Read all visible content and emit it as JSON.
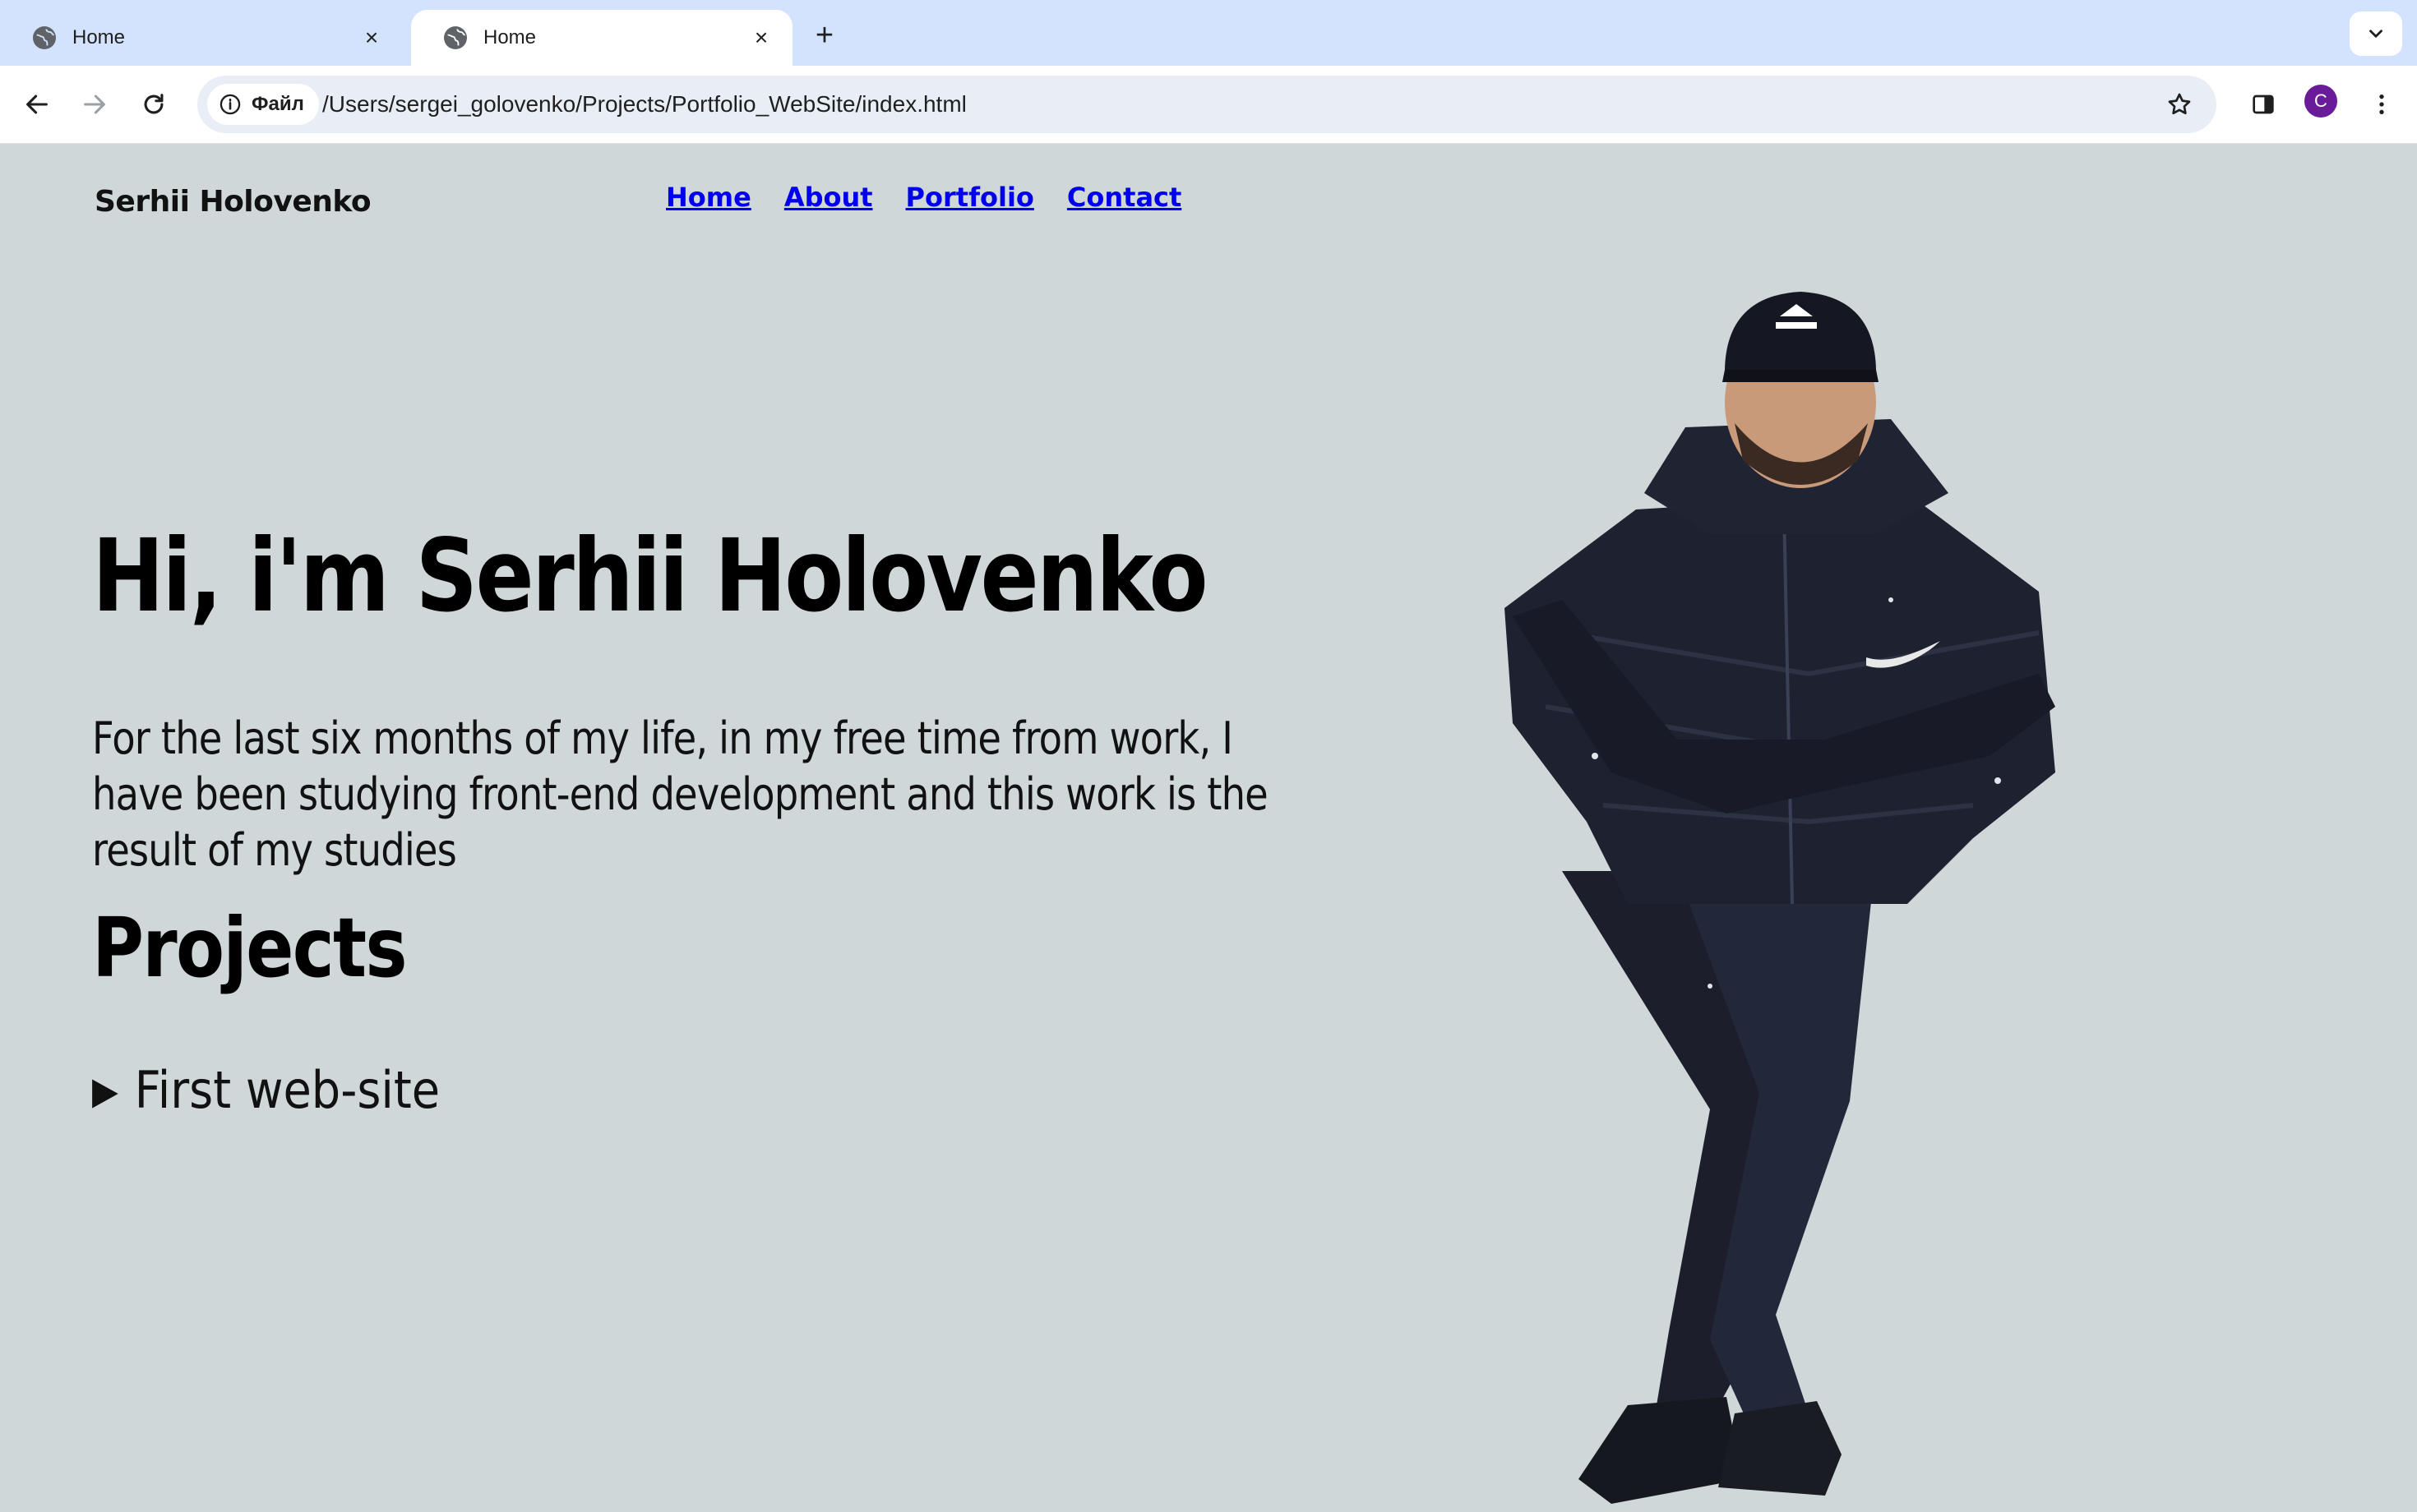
{
  "browser": {
    "tabs": [
      {
        "title": "Home",
        "active": false
      },
      {
        "title": "Home",
        "active": true
      }
    ],
    "new_tab_symbol": "+",
    "close_symbol": "×",
    "site_info_label": "Файл",
    "url": "/Users/sergei_golovenko/Projects/Portfolio_WebSite/index.html",
    "profile_initial": "C",
    "profile_color": "#6a1b9a"
  },
  "site": {
    "logo": "Serhii Holovenko",
    "nav": [
      "Home",
      "About",
      "Portfolio",
      "Contact"
    ],
    "hero_title": "Hi, i'm Serhii Holovenko",
    "hero_text": "For the last six months of my life, in my free time from work, I have been studying front-end development and this work is the result of my studies",
    "projects_heading": "Projects",
    "projects": [
      {
        "label": "First web-site",
        "expanded": false
      }
    ],
    "background_color": "#cfd7d9",
    "link_color": "#0000ee"
  },
  "icons": {
    "tab_favicon": "globe-icon",
    "back": "arrow-left-icon",
    "forward": "arrow-right-icon",
    "reload": "reload-icon",
    "site_info": "info-icon",
    "bookmark": "star-icon",
    "side_panel": "side-panel-icon",
    "menu": "kebab-menu-icon",
    "tab_list": "chevron-down-icon"
  }
}
